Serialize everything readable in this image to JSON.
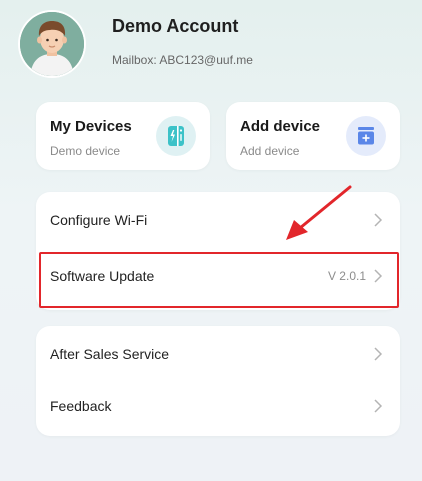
{
  "profile": {
    "name": "Demo Account",
    "mailbox": "Mailbox: ABC123@uuf.me"
  },
  "device_cards": {
    "my_devices": {
      "title": "My Devices",
      "subtitle": "Demo device",
      "icon": "device-remote-icon"
    },
    "add_device": {
      "title": "Add device",
      "subtitle": "Add device",
      "icon": "add-device-icon"
    }
  },
  "menu": {
    "configure_wifi": "Configure Wi-Fi",
    "software_update": "Software Update",
    "software_version": "V 2.0.1",
    "after_sales": "After Sales Service",
    "feedback": "Feedback"
  },
  "colors": {
    "highlight": "#e2262b",
    "accent_teal": "#3cc2c8",
    "accent_blue": "#5a86e8"
  }
}
